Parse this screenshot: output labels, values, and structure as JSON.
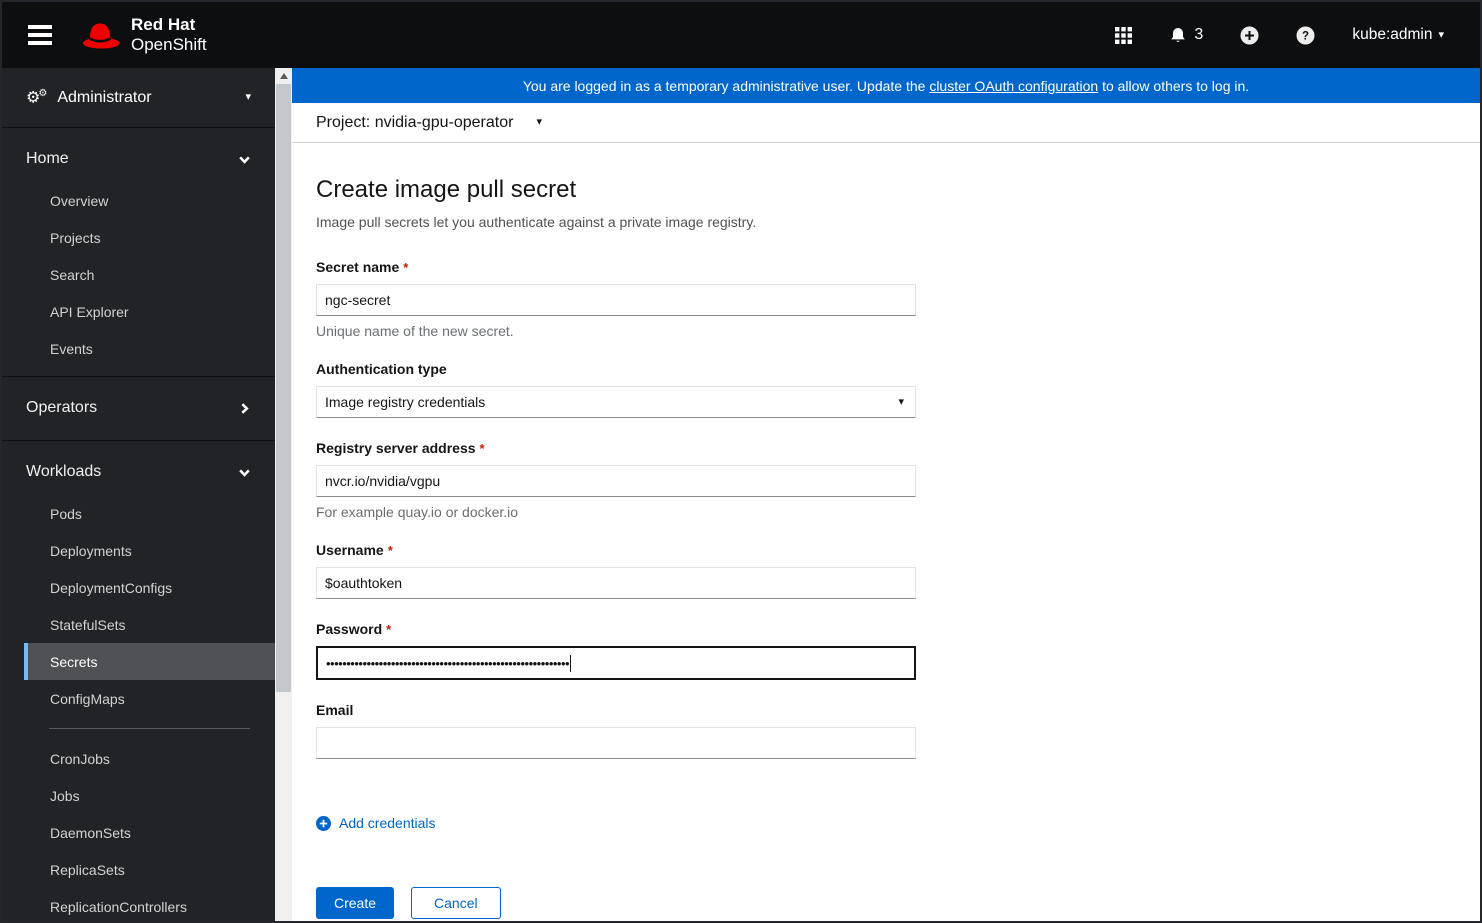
{
  "topbar": {
    "brand_line1": "Red Hat",
    "brand_line2": "OpenShift",
    "notification_count": "3",
    "user_menu_label": "kube:admin",
    "icons": {
      "menu": "hamburger-bars",
      "logo": "red-fedora",
      "app_launcher": "3x3-grid",
      "notifications": "bell",
      "add": "plus-circle",
      "help": "question-circle",
      "user_caret": "caret-down"
    }
  },
  "banner": {
    "text_before": "You are logged in as a temporary administrative user. Update the ",
    "link_text": "cluster OAuth configuration",
    "text_after": " to allow others to log in.",
    "background": "#0066cc"
  },
  "project_bar": {
    "label": "Project: nvidia-gpu-operator",
    "caret_icon": "caret-down"
  },
  "sidebar": {
    "perspective": "Administrator",
    "perspective_icon": "cogs",
    "sections": [
      {
        "label": "Home",
        "state": "expanded",
        "items": [
          {
            "label": "Overview"
          },
          {
            "label": "Projects"
          },
          {
            "label": "Search"
          },
          {
            "label": "API Explorer"
          },
          {
            "label": "Events"
          }
        ]
      },
      {
        "label": "Operators",
        "state": "collapsed",
        "items": []
      },
      {
        "label": "Workloads",
        "state": "expanded",
        "items": [
          {
            "label": "Pods"
          },
          {
            "label": "Deployments"
          },
          {
            "label": "DeploymentConfigs"
          },
          {
            "label": "StatefulSets"
          },
          {
            "label": "Secrets",
            "active": true
          },
          {
            "label": "ConfigMaps"
          },
          {
            "label": "CronJobs"
          },
          {
            "label": "Jobs"
          },
          {
            "label": "DaemonSets"
          },
          {
            "label": "ReplicaSets"
          },
          {
            "label": "ReplicationControllers"
          }
        ]
      }
    ],
    "active_item": "Secrets",
    "active_border_color": "#73bcf7"
  },
  "main": {
    "title": "Create image pull secret",
    "subtitle": "Image pull secrets let you authenticate against a private image registry.",
    "form": {
      "required_indicator": "*",
      "secret_name": {
        "label": "Secret name",
        "required": true,
        "value": "ngc-secret",
        "help": "Unique name of the new secret."
      },
      "auth_type": {
        "label": "Authentication type",
        "value": "Image registry credentials"
      },
      "registry": {
        "label": "Registry server address",
        "required": true,
        "value": "nvcr.io/nvidia/vgpu",
        "help": "For example quay.io or docker.io"
      },
      "username": {
        "label": "Username",
        "required": true,
        "value": "$oauthtoken"
      },
      "password": {
        "label": "Password",
        "required": true,
        "focused": true,
        "masked_value": "••••••••••••••••••••••••••••••••••••••••••••••••••••••••••••"
      },
      "email": {
        "label": "Email",
        "value": "",
        "placeholder": ""
      }
    },
    "add_credentials_label": "Add credentials",
    "buttons": {
      "create": "Create",
      "cancel": "Cancel"
    }
  },
  "colors": {
    "accent_blue": "#0066cc",
    "required_red": "#c9190b",
    "masthead_bg": "#0d0e10",
    "sidebar_bg": "#212427",
    "nav_active_bg": "#4f5255"
  }
}
